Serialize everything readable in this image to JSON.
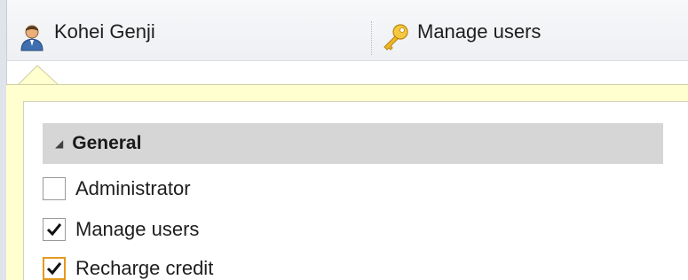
{
  "header": {
    "user": {
      "name": "Kohei Genji",
      "icon": "user-icon"
    },
    "manage": {
      "label": "Manage users",
      "icon": "key-icon"
    }
  },
  "group": {
    "title": "General",
    "expander": "◢"
  },
  "permissions": [
    {
      "label": "Administrator",
      "checked": false
    },
    {
      "label": "Manage users",
      "checked": true
    },
    {
      "label": "Recharge credit",
      "checked": true,
      "focused": true
    }
  ],
  "colors": {
    "popup_background": "#ffffd0",
    "group_header": "#d6d6d6",
    "focus_border": "#e59a1f"
  }
}
